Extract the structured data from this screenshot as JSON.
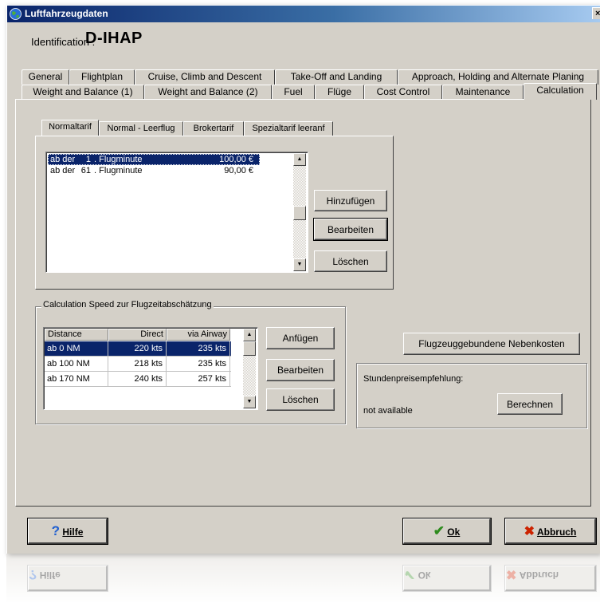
{
  "window": {
    "title": "Luftfahrzeugdaten",
    "close": "×"
  },
  "identification": {
    "label": "Identification :",
    "value": "D-IHAP"
  },
  "tabs_row1": [
    "General",
    "Flightplan",
    "Cruise, Climb and Descent",
    "Take-Off and Landing",
    "Approach, Holding and Alternate Planing"
  ],
  "tabs_row2": [
    "Weight and Balance (1)",
    "Weight and Balance (2)",
    "Fuel",
    "Flüge",
    "Cost Control",
    "Maintenance",
    "Calculation"
  ],
  "active_tab": "Calculation",
  "subtabs": [
    "Normaltarif",
    "Normal - Leerflug",
    "Brokertarif",
    "Spezialtarif leeranf"
  ],
  "active_subtab": "Normaltarif",
  "tarif_list": [
    {
      "prefix": "ab der",
      "minute": "1",
      "unit": ". Flugminute",
      "price": "100,00 €",
      "selected": true
    },
    {
      "prefix": "ab der",
      "minute": "61",
      "unit": ". Flugminute",
      "price": "90,00 €",
      "selected": false
    }
  ],
  "tarif_buttons": {
    "add": "Hinzufügen",
    "edit": "Bearbeiten",
    "delete": "Löschen"
  },
  "speed_group": {
    "label": "Calculation Speed zur Flugzeitabschätzung",
    "columns": [
      "Distance",
      "Direct",
      "via Airway"
    ],
    "rows": [
      {
        "distance": "ab 0 NM",
        "direct": "220 kts",
        "airway": "235 kts",
        "selected": true
      },
      {
        "distance": "ab 100 NM",
        "direct": "218 kts",
        "airway": "235 kts",
        "selected": false
      },
      {
        "distance": "ab 170 NM",
        "direct": "240 kts",
        "airway": "257 kts",
        "selected": false
      }
    ],
    "buttons": {
      "add": "Anfügen",
      "edit": "Bearbeiten",
      "delete": "Löschen"
    }
  },
  "extra_costs_button": "Flugzeuggebundene Nebenkosten",
  "rate_recommendation": {
    "label": "Stundenpreisempfehlung:",
    "value": "not available",
    "calc_button": "Berechnen"
  },
  "footer": {
    "help": "Hilfe",
    "ok": "Ok",
    "cancel": "Abbruch"
  },
  "colors": {
    "selection": "#0a246a",
    "face": "#d4d0c8",
    "ok_check": "#2e8b1e",
    "cancel_x": "#cc2200",
    "help_q": "#1f5fd0"
  }
}
